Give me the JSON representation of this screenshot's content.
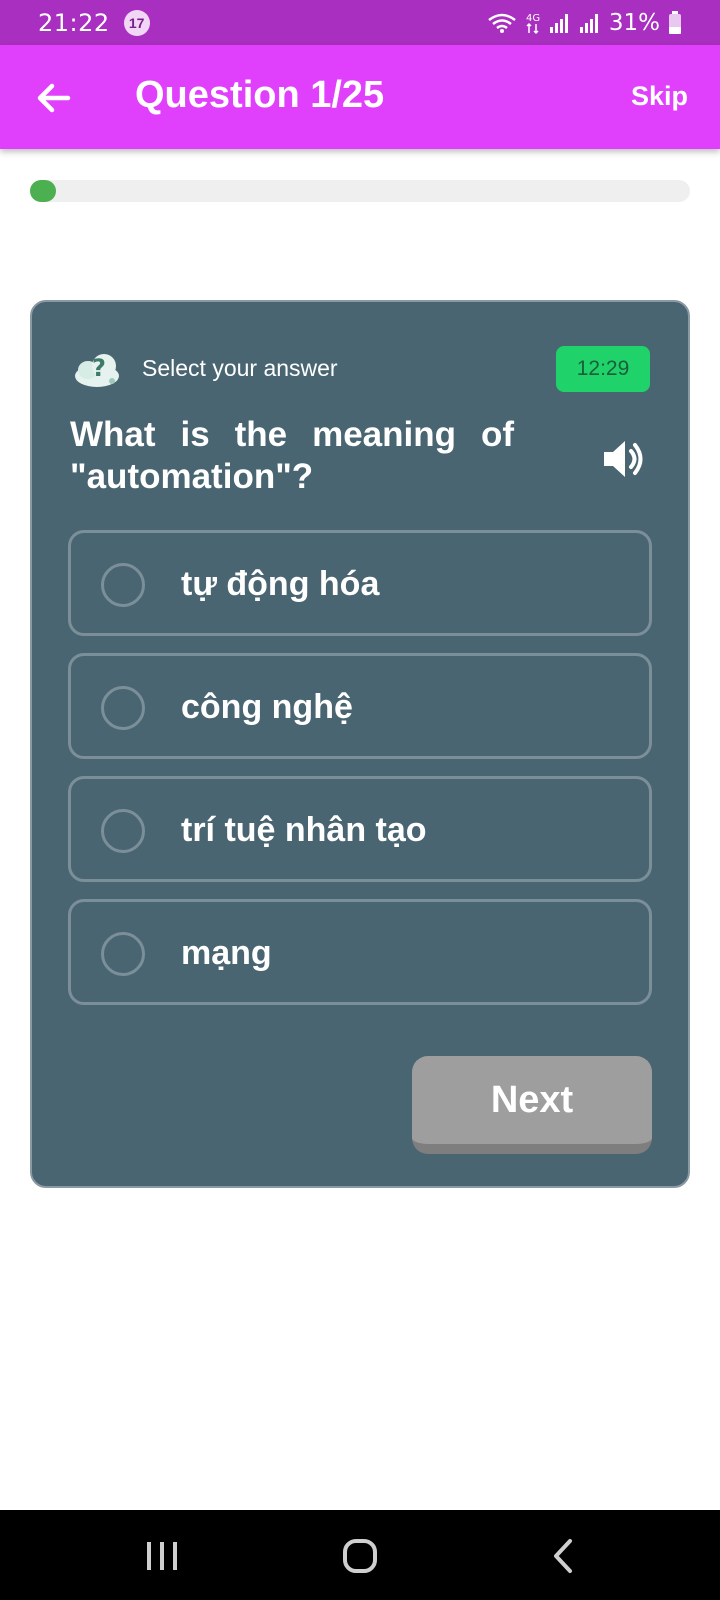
{
  "status_bar": {
    "time": "21:22",
    "notification_count": "17",
    "battery_percent": "31%",
    "network_label": "4G"
  },
  "app_bar": {
    "title": "Question 1/25",
    "skip_label": "Skip",
    "background_color": "#e040fb"
  },
  "progress": {
    "current": 1,
    "total": 25,
    "fill_color": "#4caf50"
  },
  "quiz": {
    "instruction": "Select your answer",
    "timer": "12:29",
    "question": "What is the meaning of \"automation\"?",
    "options": [
      {
        "label": "tự động hóa"
      },
      {
        "label": "công nghệ"
      },
      {
        "label": "trí tuệ nhân tạo"
      },
      {
        "label": "mạng"
      }
    ],
    "next_label": "Next",
    "card_color": "#4a6572",
    "timer_color": "#1fd26a"
  },
  "icons": {
    "back": "arrow-left-icon",
    "hint": "question-cloud-icon",
    "speaker": "speaker-icon",
    "nav_recent": "recent-apps-icon",
    "nav_home": "home-icon",
    "nav_back": "chevron-left-icon"
  }
}
